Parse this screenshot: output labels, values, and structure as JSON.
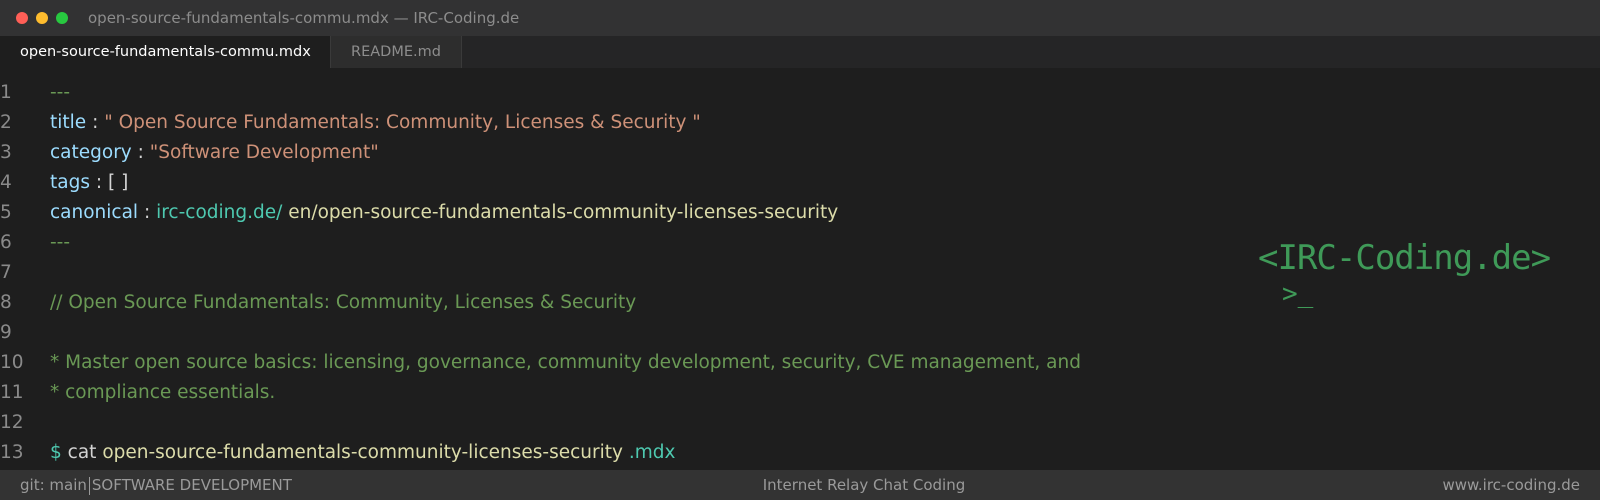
{
  "window": {
    "title": "open-source-fundamentals-commu.mdx — IRC-Coding.de"
  },
  "tabs": [
    {
      "label": "open-source-fundamentals-commu.mdx",
      "active": true
    },
    {
      "label": "README.md",
      "active": false
    }
  ],
  "editor": {
    "line_numbers": [
      "1",
      "2",
      "3",
      "4",
      "5",
      "6",
      "7",
      "8",
      "9",
      "10",
      "11",
      "12",
      "13"
    ],
    "frontmatter_delim": "---",
    "title_key": "title",
    "title_value": "\" Open Source Fundamentals: Community, Licenses & Security \"",
    "category_key": "category",
    "category_value": "\"Software Development\"",
    "tags_key": "tags",
    "tags_value": "[ ]",
    "canonical_key": "canonical",
    "canonical_domain": "irc-coding.de/",
    "canonical_path": "en/open-source-fundamentals-community-licenses-security",
    "colon": ":",
    "comment_line": "// Open Source Fundamentals: Community, Licenses & Security",
    "desc_line_1": "* Master open source basics: licensing, governance, community development, security, CVE management, and",
    "desc_line_2": "* compliance essentials.",
    "prompt_symbol": "$",
    "command": "cat",
    "command_file": "open-source-fundamentals-community-licenses-security",
    "command_ext": ".mdx"
  },
  "logo": {
    "text": "<IRC-Coding.de>",
    "prompt": ">_"
  },
  "statusbar": {
    "branch": "git: main",
    "category": "SOFTWARE DEVELOPMENT",
    "center": "Internet Relay Chat Coding",
    "right": "www.irc-coding.de"
  },
  "colors": {
    "background": "#1e1e1e",
    "titlebar": "#323233",
    "statusbar": "#333333",
    "comment_green": "#6a9955",
    "key_blue": "#9cdcfe",
    "string_orange": "#ce9178",
    "teal": "#4ec9b0",
    "yellow": "#dcdcaa",
    "logo_green": "#3f9a58"
  }
}
